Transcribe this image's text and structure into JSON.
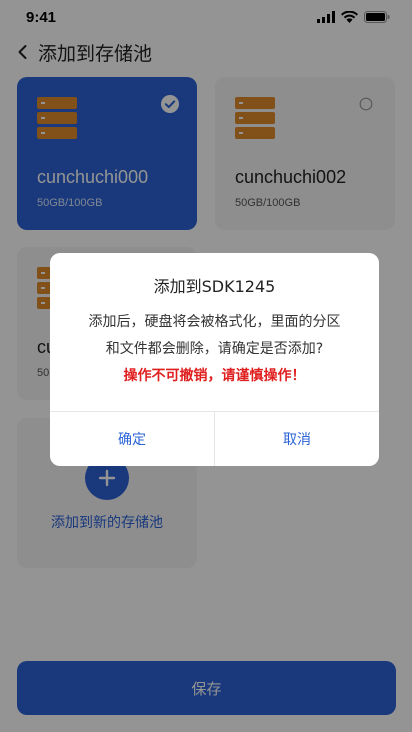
{
  "status_bar": {
    "time": "9:41"
  },
  "nav": {
    "title": "添加到存储池"
  },
  "pools": [
    {
      "name": "cunchuchi000",
      "capacity": "50GB/100GB",
      "selected": true
    },
    {
      "name": "cunchuchi002",
      "capacity": "50GB/100GB",
      "selected": false
    },
    {
      "name": "cu",
      "capacity": "50",
      "selected": false
    }
  ],
  "add_pool": {
    "label": "添加到新的存储池"
  },
  "save_button": {
    "label": "保存"
  },
  "dialog": {
    "title": "添加到SDK1245",
    "message_line1": "添加后，硬盘将会被格式化，里面的分区",
    "message_line2": "和文件都会删除，请确定是否添加?",
    "warning": "操作不可撤销，请谨慎操作！",
    "confirm_label": "确定",
    "cancel_label": "取消"
  },
  "colors": {
    "accent": "#2b63d6",
    "warning": "#e01f1f",
    "disk_orange": "#e08a2b"
  }
}
